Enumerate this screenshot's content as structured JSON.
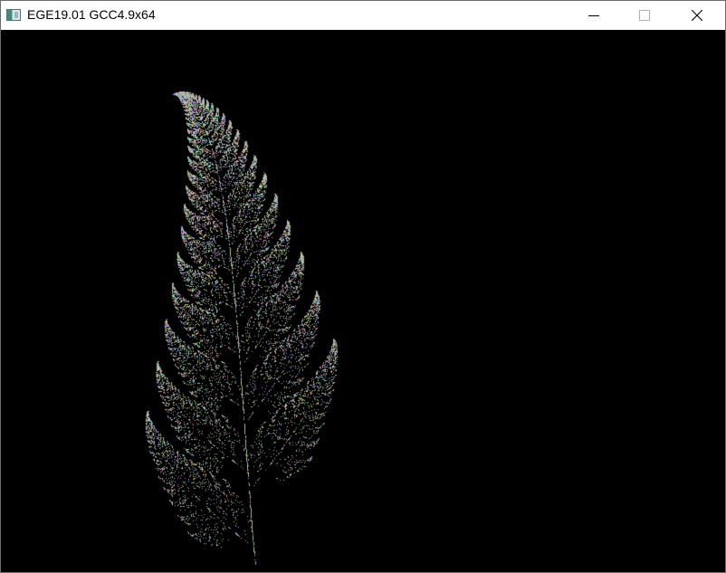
{
  "window": {
    "title": "EGE19.01 GCC4.9x64",
    "app_icon": "window-app-icon",
    "controls": {
      "minimize_icon": "minimize-icon",
      "maximize_icon": "maximize-icon",
      "close_icon": "close-icon"
    }
  },
  "canvas": {
    "background": "#000000",
    "drawing": "barnsley-fern",
    "point_colors": [
      "#c98fb4",
      "#6fb8b0",
      "#a8b86a",
      "#b07fd0",
      "#e0a0a0",
      "#8fc0e8",
      "#d0d080",
      "#90e090"
    ]
  }
}
